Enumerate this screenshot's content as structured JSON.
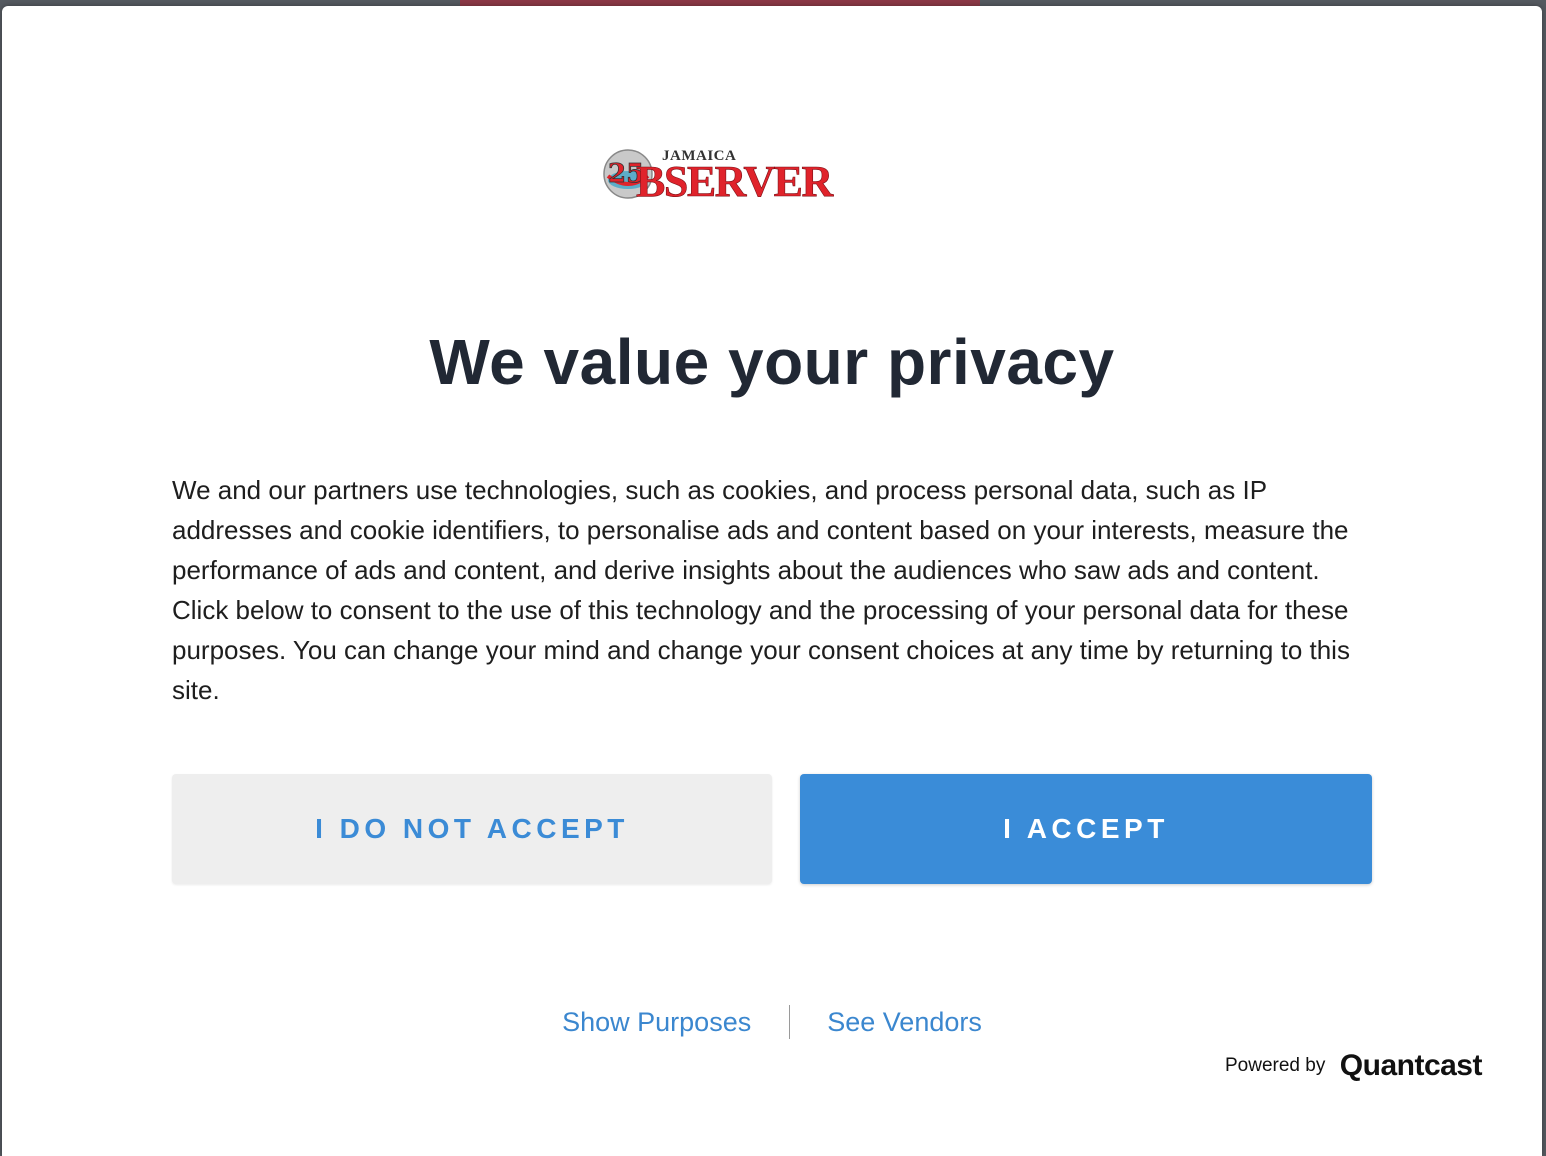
{
  "logo": {
    "top_text": "JAMAICA",
    "main_text": "BSERVER",
    "emblem_text": "25",
    "colors": {
      "red": "#e0232b",
      "dark": "#222222"
    }
  },
  "dialog": {
    "title": "We value your privacy",
    "body": "We and our partners use technologies, such as cookies, and process personal data, such as IP addresses and cookie identifiers, to personalise ads and content based on your interests, measure the performance of ads and content, and derive insights about the audiences who saw ads and content. Click below to consent to the use of this technology and the processing of your personal data for these purposes. You can change your mind and change your consent choices at any time by returning to this site.",
    "reject_label": "I DO NOT ACCEPT",
    "accept_label": "I ACCEPT",
    "show_purposes_label": "Show Purposes",
    "see_vendors_label": "See Vendors",
    "powered_by_label": "Powered by",
    "powered_by_brand": "Quantcast"
  },
  "colors": {
    "accent": "#3a8cd8",
    "title": "#212834",
    "reject_bg": "#eeeeee"
  }
}
